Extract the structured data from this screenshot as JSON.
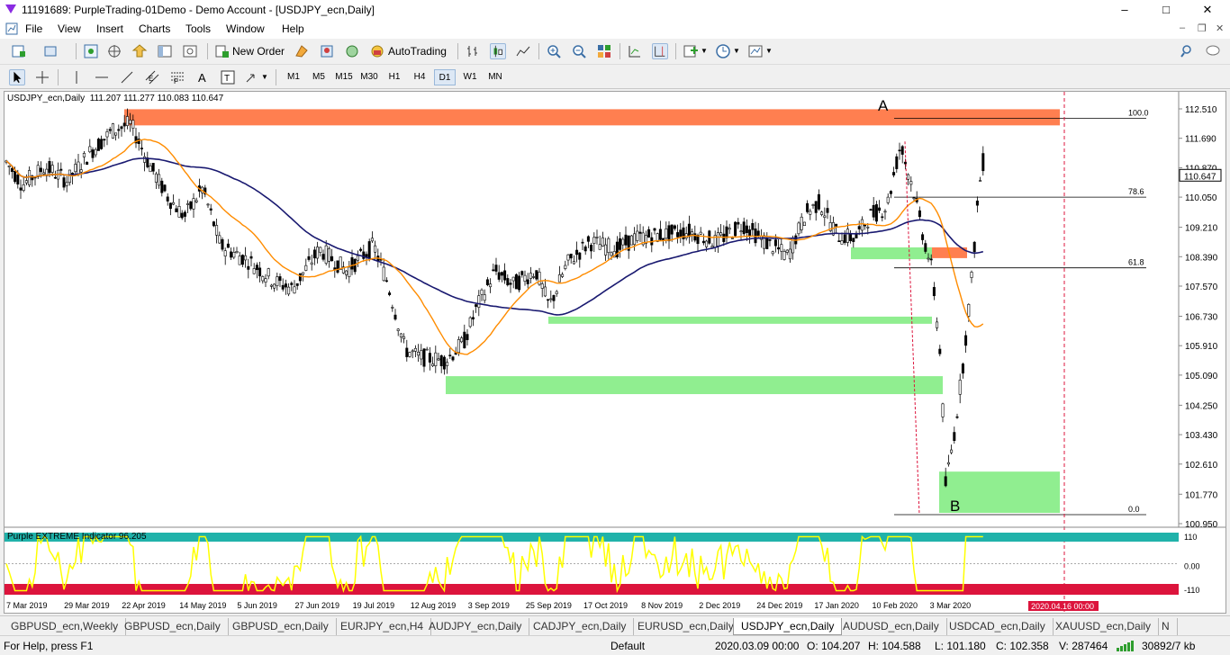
{
  "window": {
    "title": "11191689: PurpleTrading-01Demo - Demo Account - [USDJPY_ecn,Daily]",
    "minimize": "–",
    "maximize": "□",
    "close": "✕"
  },
  "menu": {
    "items": [
      "File",
      "View",
      "Insert",
      "Charts",
      "Tools",
      "Window",
      "Help"
    ],
    "child_min": "–",
    "child_restore": "❐",
    "child_close": "✕"
  },
  "toolbar": {
    "new_order": "New Order",
    "autotrading": "AutoTrading",
    "timeframes": [
      "M1",
      "M5",
      "M15",
      "M30",
      "H1",
      "H4",
      "D1",
      "W1",
      "MN"
    ],
    "active_timeframe": "D1"
  },
  "chart": {
    "header": "USDJPY_ecn,Daily  111.207 111.277 110.083 110.647",
    "label_a": "A",
    "label_b": "B",
    "price_ticks": [
      "112.510",
      "111.690",
      "110.870",
      "110.050",
      "109.210",
      "108.390",
      "107.570",
      "106.730",
      "105.910",
      "105.090",
      "104.250",
      "103.430",
      "102.610",
      "101.770",
      "100.950"
    ],
    "current_price": "110.647",
    "fib_levels": [
      "100.0",
      "78.6",
      "61.8",
      "0.0"
    ],
    "date_ticks": [
      "7 Mar 2019",
      "29 Mar 2019",
      "22 Apr 2019",
      "14 May 2019",
      "5 Jun 2019",
      "27 Jun 2019",
      "19 Jul 2019",
      "12 Aug 2019",
      "3 Sep 2019",
      "25 Sep 2019",
      "17 Oct 2019",
      "8 Nov 2019",
      "2 Dec 2019",
      "24 Dec 2019",
      "17 Jan 2020",
      "10 Feb 2020",
      "3 Mar 2020"
    ],
    "future_date": "2020.04.16 00:00",
    "colors": {
      "supply_zone": "#ff7f50",
      "demand_zone": "#90ee90",
      "ma_fast": "#ff8c00",
      "ma_slow": "#191970",
      "oscillator": "#ffff00",
      "overbought_band": "#20b2aa",
      "oversold_band": "#dc143c"
    }
  },
  "indicator": {
    "label": "Purple EXTREME Indicator 96.205",
    "ticks": [
      "110",
      "0.00",
      "-110"
    ]
  },
  "tabs": [
    "GBPUSD_ecn,Weekly",
    "GBPUSD_ecn,Daily",
    "GBPUSD_ecn,Daily",
    "EURJPY_ecn,H4",
    "AUDJPY_ecn,Daily",
    "CADJPY_ecn,Daily",
    "EURUSD_ecn,Daily",
    "USDJPY_ecn,Daily",
    "AUDUSD_ecn,Daily",
    "USDCAD_ecn,Daily",
    "XAUUSD_ecn,Daily",
    "N"
  ],
  "active_tab": "USDJPY_ecn,Daily",
  "status": {
    "help": "For Help, press F1",
    "profile": "Default",
    "datetime": "2020.03.09 00:00",
    "open": "O: 104.207",
    "high": "H: 104.588",
    "low": "L: 101.180",
    "close": "C: 102.358",
    "volume": "V: 287464",
    "traffic": "30892/7 kb"
  }
}
